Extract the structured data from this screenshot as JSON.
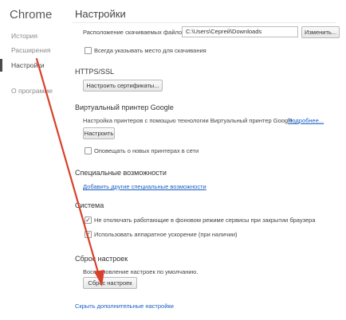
{
  "app": {
    "title": "Chrome"
  },
  "sidebar": {
    "items": [
      {
        "label": "История"
      },
      {
        "label": "Расширения"
      },
      {
        "label": "Настройки"
      },
      {
        "label": "О программе"
      }
    ]
  },
  "page": {
    "title": "Настройки"
  },
  "downloads": {
    "location_label": "Расположение скачиваемых файлов:",
    "path_value": "C:\\Users\\Сергей\\Downloads",
    "change_button": "Изменить...",
    "ask_label": "Всегда указывать место для скачивания",
    "ask_checked": false
  },
  "https": {
    "heading": "HTTPS/SSL",
    "certs_button": "Настроить сертификаты..."
  },
  "cloud_print": {
    "heading": "Виртуальный принтер Google",
    "description": "Настройка принтеров с помощью технологии Виртуальный принтер Google.",
    "more_link": "Подробнее...",
    "setup_button": "Настроить",
    "notify_label": "Оповещать о новых принтерах в сети",
    "notify_checked": false
  },
  "accessibility": {
    "heading": "Специальные возможности",
    "add_link": "Добавить другие специальные возможности"
  },
  "system": {
    "heading": "Система",
    "background_label": "Не отключать работающие в фоновом режиме сервисы при закрытии браузера",
    "background_checked": true,
    "hw_accel_label": "Использовать аппаратное ускорение (при наличии)",
    "hw_accel_checked": true
  },
  "reset": {
    "heading": "Сброс настроек",
    "description": "Восстановление настроек по умолчанию.",
    "button": "Сброс настроек"
  },
  "footer": {
    "hide_advanced_link": "Скрыть дополнительные настройки"
  },
  "annotation": {
    "arrow_color": "#d9402b"
  },
  "theme": {
    "link_color": "#1a5ec6",
    "active_nav_color": "#4a4a4a"
  }
}
